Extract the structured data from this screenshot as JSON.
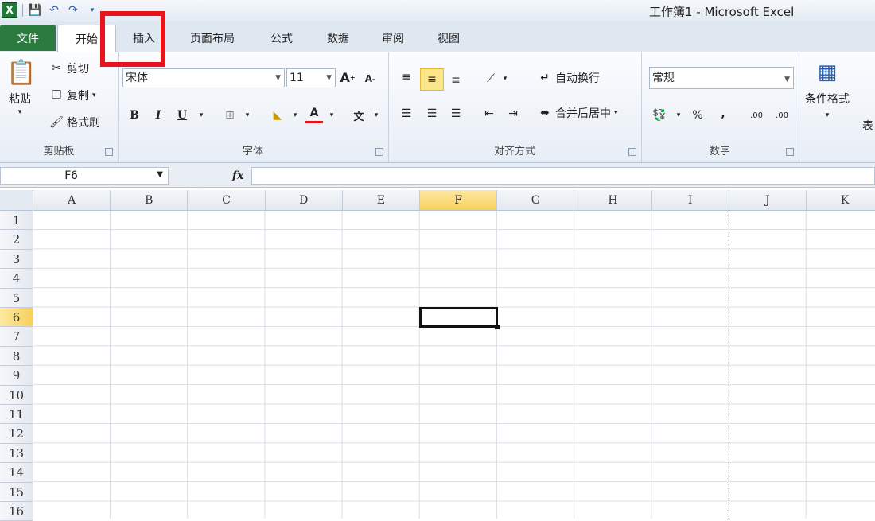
{
  "titlebar": {
    "title": "工作簿1  -  Microsoft Excel",
    "logo": "X"
  },
  "tabs": {
    "file": "文件",
    "items": [
      "开始",
      "插入",
      "页面布局",
      "公式",
      "数据",
      "审阅",
      "视图"
    ],
    "active_index": 0
  },
  "clipboard": {
    "paste": "粘贴",
    "cut": "剪切",
    "copy": "复制",
    "format_painter": "格式刷",
    "label": "剪贴板"
  },
  "font": {
    "name": "宋体",
    "size": "11",
    "bold": "B",
    "italic": "I",
    "underline": "U",
    "label": "字体"
  },
  "alignment": {
    "wrap": "自动换行",
    "merge": "合并后居中",
    "label": "对齐方式"
  },
  "number": {
    "format": "常规",
    "percent": "%",
    "comma": ",",
    "inc_decimal": ".00",
    "dec_decimal": ".00",
    "label": "数字"
  },
  "styles": {
    "conditional": "条件格式",
    "table_partial": "表"
  },
  "formula_bar": {
    "name_box": "F6",
    "fx": "fx",
    "content": ""
  },
  "columns": [
    "A",
    "B",
    "C",
    "D",
    "E",
    "F",
    "G",
    "H",
    "I",
    "J",
    "K"
  ],
  "rows": [
    "1",
    "2",
    "3",
    "4",
    "5",
    "6",
    "7",
    "8",
    "9",
    "10",
    "11",
    "12",
    "13",
    "14",
    "15",
    "16"
  ],
  "selection": {
    "column": "F",
    "row": "6"
  },
  "colors": {
    "file_tab": "#2b7a3e",
    "highlight": "#e8131b",
    "selected_header": "#f8cf5c"
  }
}
